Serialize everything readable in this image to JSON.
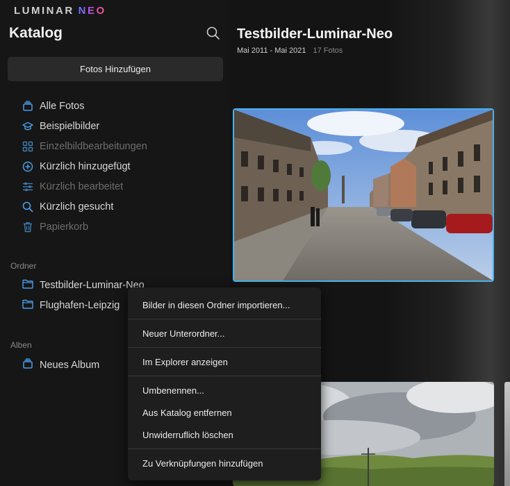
{
  "app": {
    "logo_part1": "LUMINAR",
    "logo_part2": "NEO"
  },
  "sidebar": {
    "title": "Katalog",
    "add_photos_label": "Fotos Hinzufügen",
    "nav_items": [
      {
        "label": "Alle Fotos",
        "icon": "stack-icon",
        "dim": false
      },
      {
        "label": "Beispielbilder",
        "icon": "graduation-cap-icon",
        "dim": false
      },
      {
        "label": "Einzelbildbearbeitungen",
        "icon": "grid-icon",
        "dim": true
      },
      {
        "label": "Kürzlich hinzugefügt",
        "icon": "plus-circle-icon",
        "dim": false
      },
      {
        "label": "Kürzlich bearbeitet",
        "icon": "sliders-icon",
        "dim": true
      },
      {
        "label": "Kürzlich gesucht",
        "icon": "search-icon",
        "dim": false
      },
      {
        "label": "Papierkorb",
        "icon": "trash-icon",
        "dim": true
      }
    ],
    "folders_label": "Ordner",
    "folders": [
      {
        "label": "Testbilder-Luminar-Neo"
      },
      {
        "label": "Flughafen-Leipzig"
      }
    ],
    "albums_label": "Alben",
    "albums": [
      {
        "label": "Neues Album"
      }
    ]
  },
  "main": {
    "title": "Testbilder-Luminar-Neo",
    "date_range": "Mai 2011 - Mai 2021",
    "count": "17 Fotos"
  },
  "context_menu": {
    "items": [
      "Bilder in diesen Ordner importieren...",
      "Neuer Unterordner...",
      "Im Explorer anzeigen",
      "Umbenennen...",
      "Aus Katalog entfernen",
      "Unwiderruflich löschen",
      "Zu Verknüpfungen hinzufügen"
    ]
  },
  "colors": {
    "accent": "#47b3f0",
    "icon_blue": "#4a9ee8",
    "background": "#151515"
  }
}
